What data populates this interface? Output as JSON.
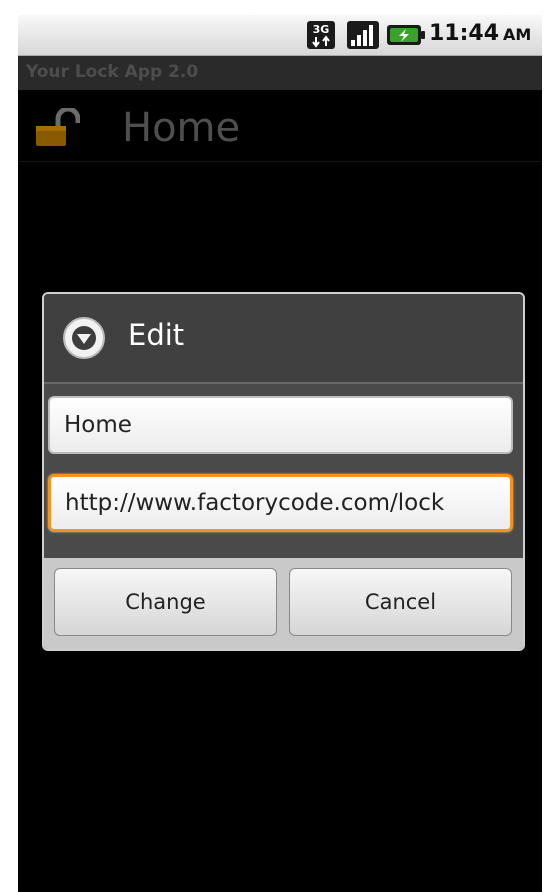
{
  "status_bar": {
    "time": "11:44",
    "ampm": "AM",
    "network_icon": "network-3g-icon",
    "signal_icon": "signal-strength-icon",
    "battery_icon": "battery-charging-icon",
    "network_label": "3G"
  },
  "app": {
    "title": "Your Lock App 2.0"
  },
  "page": {
    "title": "Home",
    "icon": "lock-open-icon"
  },
  "dialog": {
    "title": "Edit",
    "icon": "chevron-down-circle-icon",
    "name_value": "Home",
    "url_value": "http://www.factorycode.com/lock",
    "change_label": "Change",
    "cancel_label": "Cancel"
  },
  "colors": {
    "focus_border": "#f4931e",
    "lock_icon": "#8a5a00",
    "battery_green": "#3aa12c"
  }
}
